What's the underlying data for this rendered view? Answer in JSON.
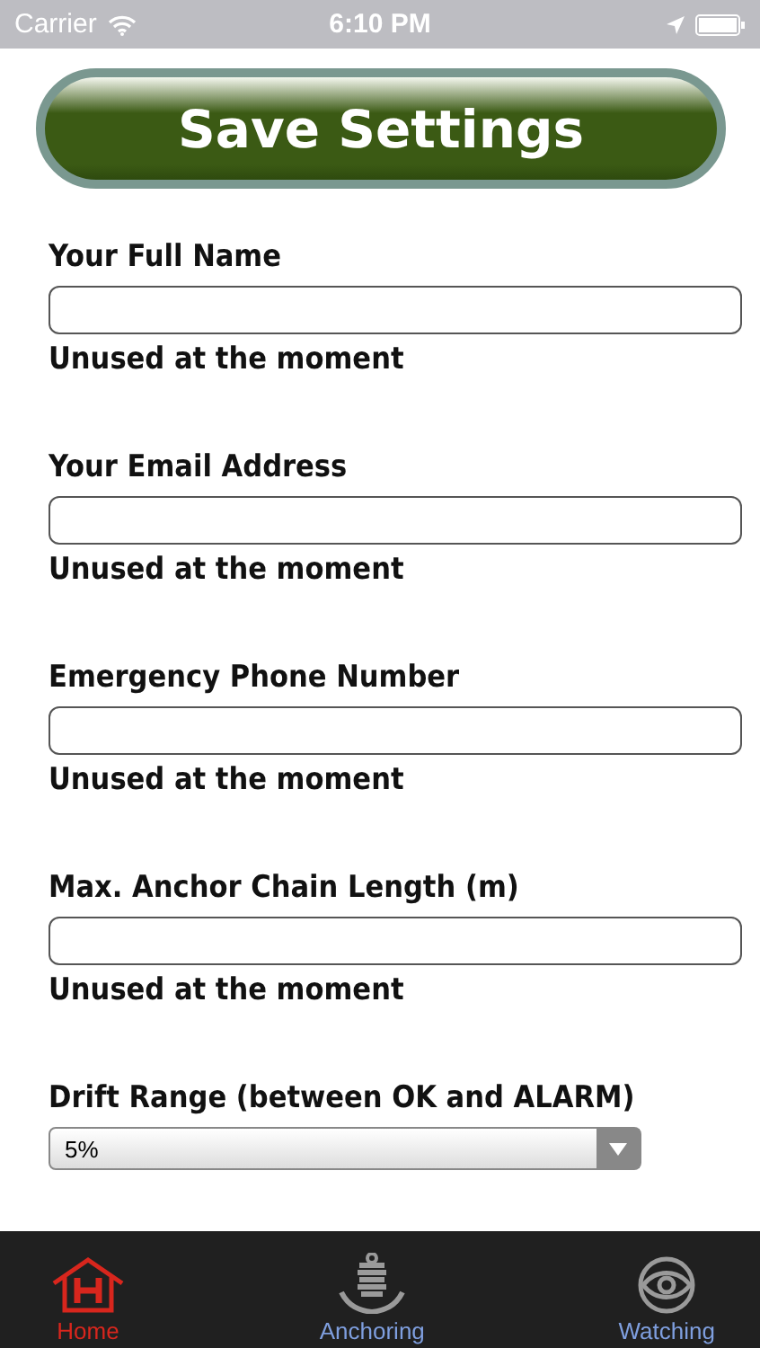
{
  "status_bar": {
    "carrier": "Carrier",
    "time": "6:10 PM"
  },
  "save_button": {
    "label": "Save Settings"
  },
  "fields": [
    {
      "label": "Your Full Name",
      "note": "Unused at the moment"
    },
    {
      "label": "Your Email Address",
      "note": "Unused at the moment"
    },
    {
      "label": "Emergency Phone Number",
      "note": "Unused at the moment"
    },
    {
      "label": "Max. Anchor Chain Length (m)",
      "note": "Unused at the moment"
    }
  ],
  "drift_range": {
    "label": "Drift Range (between OK and ALARM)",
    "value": "5%"
  },
  "tabs": [
    {
      "label": "Home",
      "kind": "home",
      "selected": true
    },
    {
      "label": "Anchoring",
      "kind": "anchor",
      "selected": false
    },
    {
      "label": "Watching",
      "kind": "eye",
      "selected": false
    }
  ]
}
